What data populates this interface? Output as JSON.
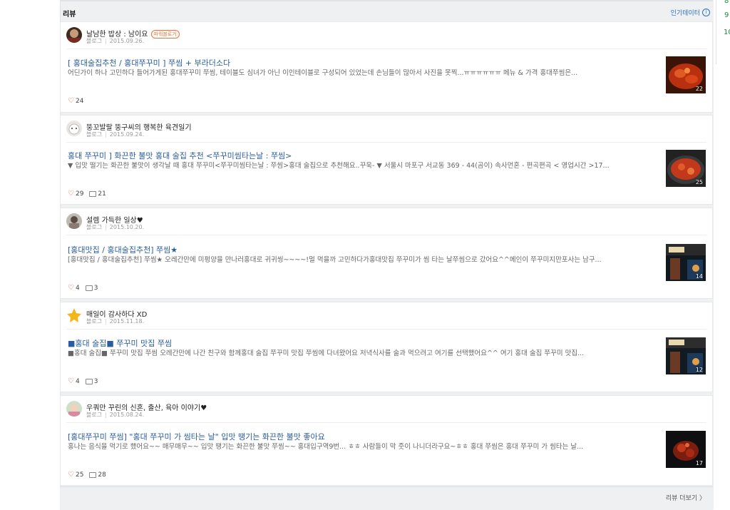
{
  "section": {
    "title": "리뷰",
    "more_label": "인기테이터",
    "more_icon": "info-icon"
  },
  "right_panel": {
    "values": [
      "8",
      "9",
      "10"
    ]
  },
  "reviews": [
    {
      "author": "날남한 밥상 : 남이요",
      "badge": "파워블로거",
      "source": "블로그",
      "date": "2015.09.26.",
      "title": "[ 홍대술집추천 / 홍대쭈꾸미 ] 쭈씸 + 부라더소다",
      "text": "어딘가이 하나 고민하다 들어가게된 홍대쭈꾸미 쭈씸, 테이블도 심녀가 아닌 이인테이블로 구성되어 있었는데 손님들이 많아서 사진을 못찍...ㅠㅠㅠㅠㅠㅠ 메뉴 & 가격 홍대쭈씸은...",
      "likes": "24",
      "comments": "",
      "thumb_count": "22"
    },
    {
      "author": "뚱꼬발랄 뚱구씨의 행복한 육견일기",
      "badge": "",
      "source": "블로그",
      "date": "2015.09.24.",
      "title": "홍대 쭈꾸미 ] 화끈한 불맛 홍대 술집 추천 <쭈꾸미씸타는날 : 쭈씸>",
      "text": "▼ 입맛 떨기는 화끈한 불맛이 생각날 때 홍대 쭈꾸미<쭈꾸미씸타는날 : 쭈씸>홍대 술집으로 추천해요..꾸욱- ▼ 서울시 마포구 서교동 369 - 44(곰이) 속사먼혼 - 편곡편곡 < 영업시간 >17...",
      "likes": "29",
      "comments": "21",
      "thumb_count": "25"
    },
    {
      "author": "설렘 가득한 일상♥",
      "badge": "",
      "source": "블로그",
      "date": "2015.10.20.",
      "title": "[홍대맛집 / 홍대술집추천] 쭈씸★",
      "text": "[홍대맛집 / 홍대술집추천] 쭈씸★ 오레간만에 미펑양을 만나러홍대로 귀귀씽~~~~!멀 먹을까 고민하다가홍대맛집 쭈꾸미가 씸 타는 날쭈씸으로 갔어요^^메인이 쭈꾸미지만포사는 남구...",
      "likes": "4",
      "comments": "3",
      "thumb_count": "14"
    },
    {
      "author": "매일이 감사하다 XD",
      "badge": "",
      "source": "블로그",
      "date": "2015.11.18.",
      "title": "■홍대 술집■ 쭈꾸미 맛집 쭈씸",
      "text": "■홍대 술집■ 쭈꾸미 맛집 쭈씸 오레간만에 나간 친구와 함께홍대 술집 쭈꾸미 맛집 쭈씸에 다녀왔어요 저녁식사를 술과 먹으려고 여기를 선택했어요^^ 여기 홍대 술집 쭈꾸미 맛집...",
      "likes": "4",
      "comments": "3",
      "thumb_count": "12"
    },
    {
      "author": "우쿼만 꾸린의 신혼, 출산, 육아 이야기♥",
      "badge": "",
      "source": "블로그",
      "date": "2015.08.24.",
      "title": "[홍대쭈꾸미 쭈씸] \"홍대 쭈꾸미 가 씸타는 날\" 입맛 땡기는 화끈한 불맛 좋아요",
      "text": "홍나는 음식을 먹기로 했어요~~ 매무매무~~ 입맛 땡기는 화끈한 불맛 쭈씸~~ 홍대입구역9번... ㅎㅎ 사람들이 막 줏이 나니더라구요~ㅎㅎ 홍대 쭈씸은 홍대 쭈꾸미 가 씸타는 날...",
      "likes": "25",
      "comments": "28",
      "thumb_count": "17"
    }
  ],
  "footer": {
    "more_label": "리뷰 더보기 〉"
  }
}
